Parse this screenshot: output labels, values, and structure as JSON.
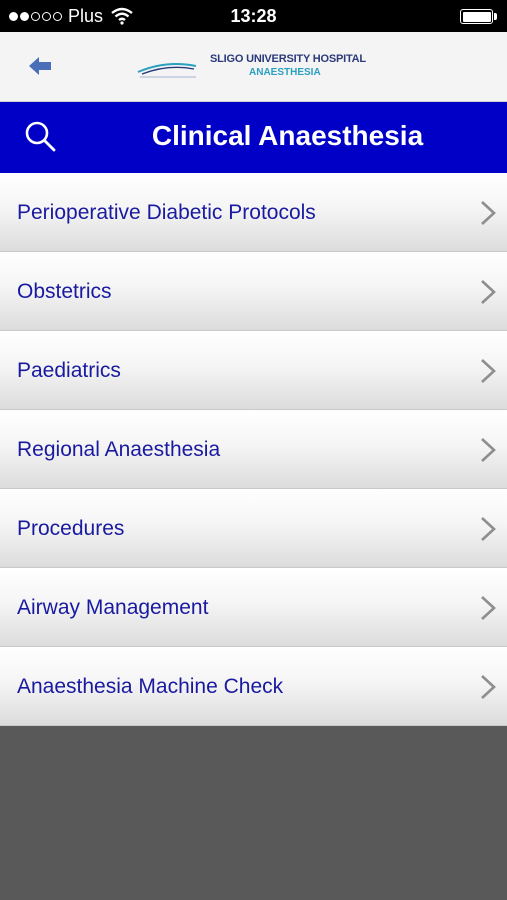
{
  "status_bar": {
    "carrier": "Plus",
    "time": "13:28",
    "signal_filled": 2,
    "signal_total": 5
  },
  "nav": {
    "back_icon": "arrow-left-icon",
    "logo": {
      "name": "SLIGO UNIVERSITY HOSPITAL",
      "dept": "ANAESTHESIA"
    }
  },
  "header": {
    "title": "Clinical Anaesthesia",
    "search_icon": "search-icon"
  },
  "menu": {
    "items": [
      {
        "label": "Perioperative Diabetic Protocols"
      },
      {
        "label": "Obstetrics"
      },
      {
        "label": "Paediatrics"
      },
      {
        "label": "Regional Anaesthesia"
      },
      {
        "label": "Procedures"
      },
      {
        "label": "Airway Management"
      },
      {
        "label": "Anaesthesia Machine Check"
      }
    ]
  },
  "colors": {
    "header_bg": "#0000c6",
    "item_text": "#1a1aa0",
    "background": "#595959"
  }
}
